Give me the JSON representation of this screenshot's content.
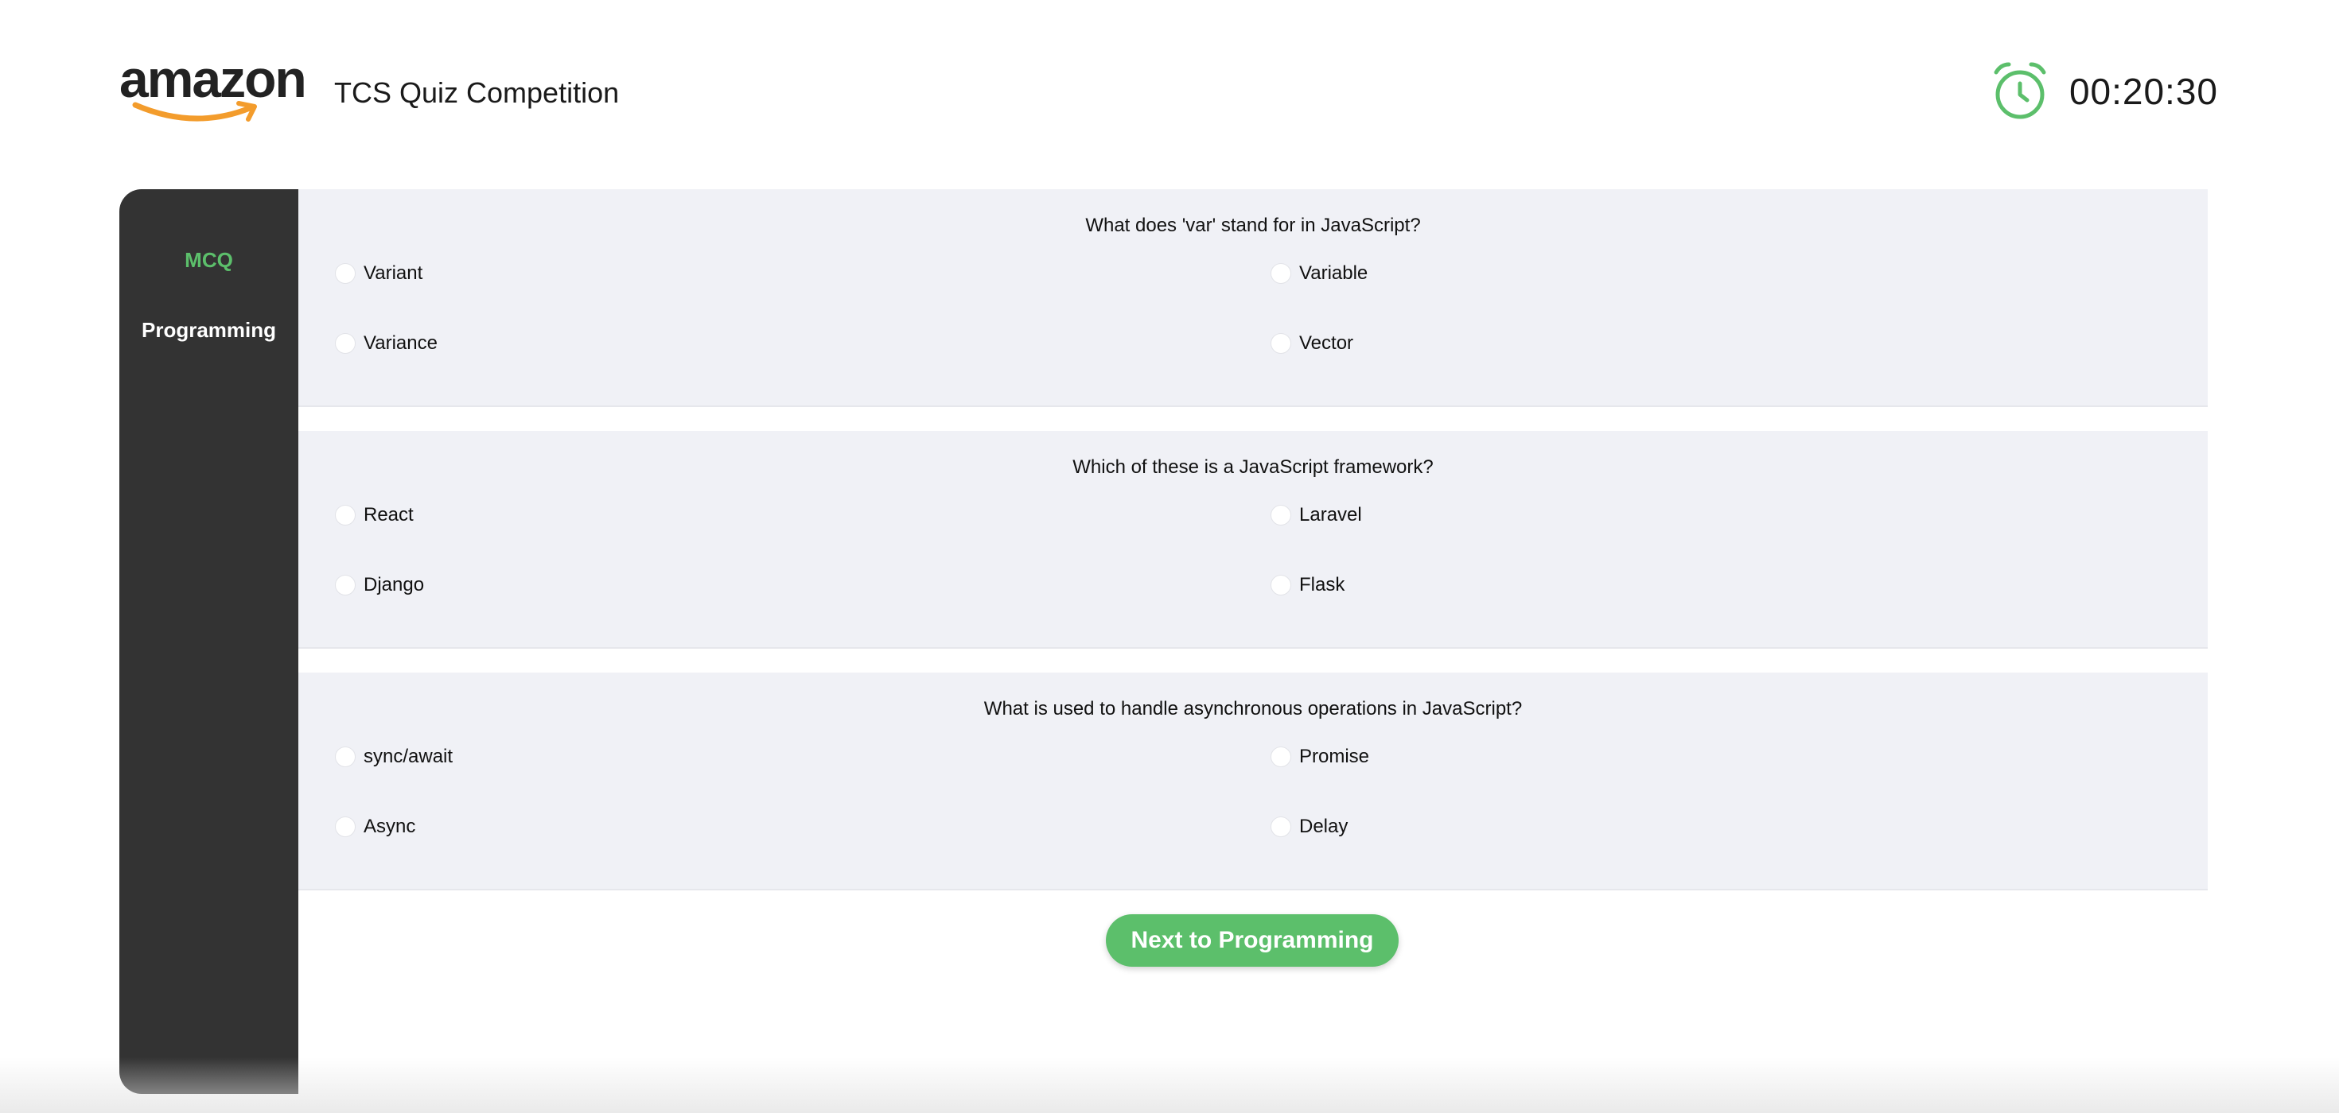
{
  "header": {
    "logo_text": "amazon",
    "app_title": "TCS Quiz Competition",
    "timer": "00:20:30",
    "timer_icon": "alarm-clock-icon"
  },
  "colors": {
    "accent": "#5cbf6b",
    "sidebar": "#333333",
    "card_bg": "#f0f1f6",
    "logo_smile": "#f39c2c"
  },
  "sidebar": {
    "items": [
      {
        "label": "MCQ",
        "active": true
      },
      {
        "label": "Programming",
        "active": false
      }
    ]
  },
  "questions": [
    {
      "text": "What does 'var' stand for in JavaScript?",
      "options": [
        "Variant",
        "Variable",
        "Variance",
        "Vector"
      ]
    },
    {
      "text": "Which of these is a JavaScript framework?",
      "options": [
        "React",
        "Laravel",
        "Django",
        "Flask"
      ]
    },
    {
      "text": "What is used to handle asynchronous operations in JavaScript?",
      "options": [
        "sync/await",
        "Promise",
        "Async",
        "Delay"
      ]
    }
  ],
  "next_button": "Next to Programming"
}
